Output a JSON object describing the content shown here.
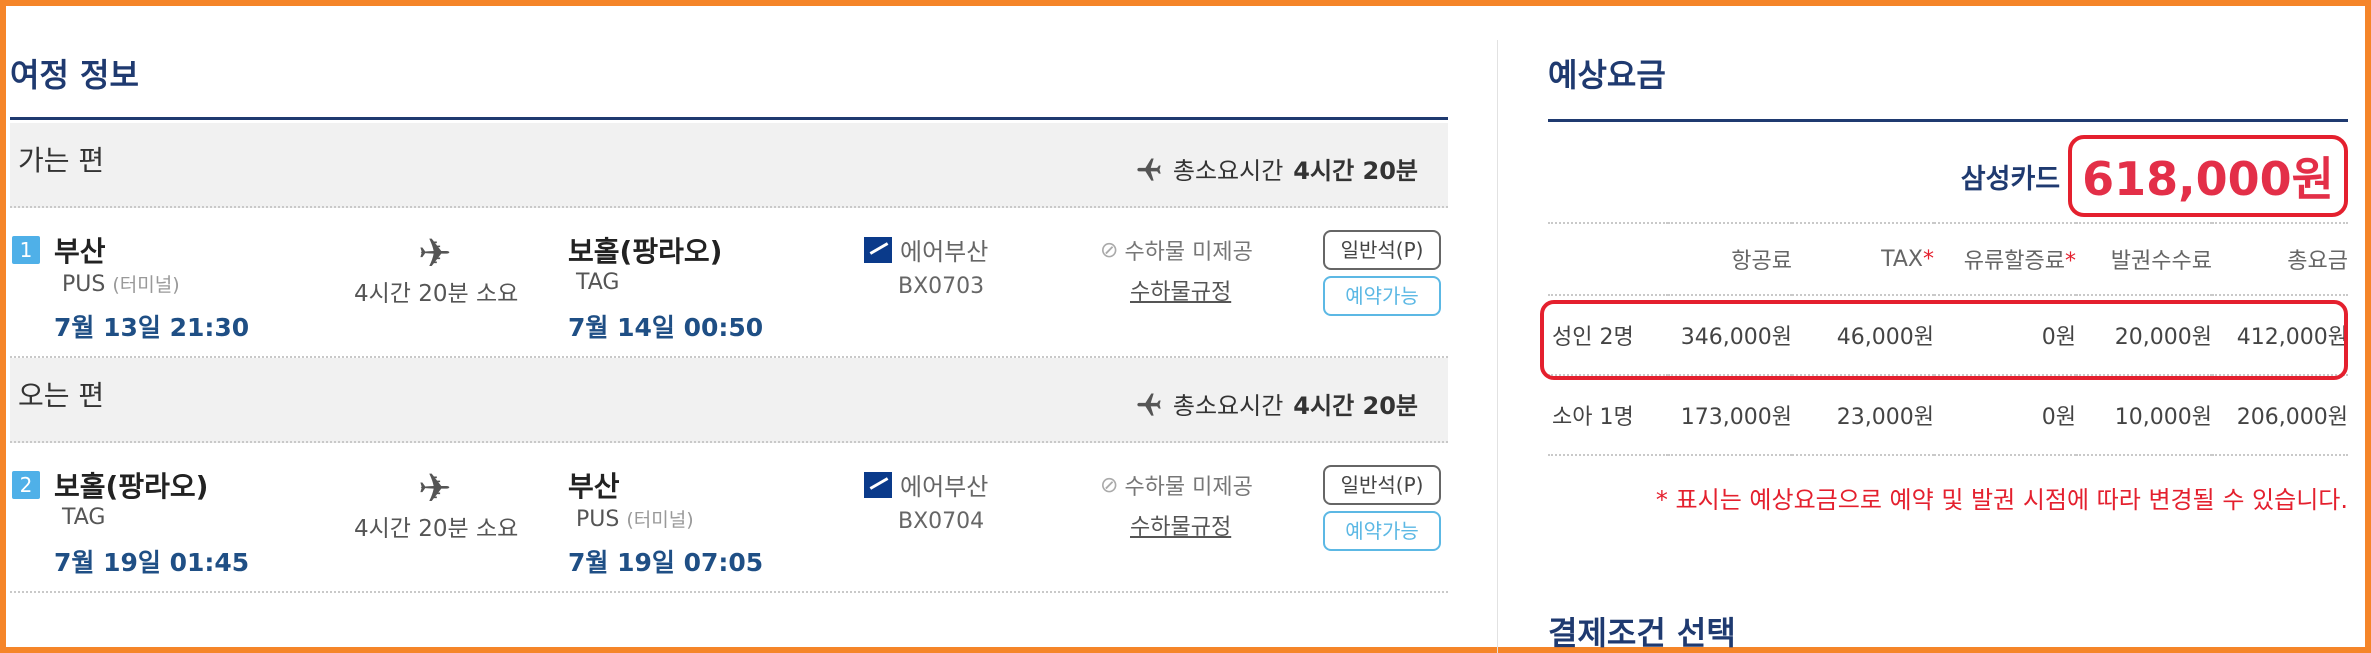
{
  "itinerary": {
    "title": "여정 정보",
    "segments": [
      {
        "label": "가는 편",
        "total_label": "총소요시간",
        "total_value": "4시간 20분",
        "number": "1",
        "dep_city": "부산",
        "dep_code": "PUS",
        "dep_terminal": "(터미널)",
        "dep_datetime": "7월 13일 21:30",
        "duration": "4시간 20분 소요",
        "arr_city": "보홀(팡라오)",
        "arr_code": "TAG",
        "arr_terminal": "",
        "arr_datetime": "7월 14일 00:50",
        "airline": "에어부산",
        "flight_no": "BX0703",
        "baggage": "수하물 미제공",
        "baggage_rule": "수하물규정",
        "seat_class": "일반석(P)",
        "availability": "예약가능"
      },
      {
        "label": "오는 편",
        "total_label": "총소요시간",
        "total_value": "4시간 20분",
        "number": "2",
        "dep_city": "보홀(팡라오)",
        "dep_code": "TAG",
        "dep_terminal": "",
        "dep_datetime": "7월 19일 01:45",
        "duration": "4시간 20분 소요",
        "arr_city": "부산",
        "arr_code": "PUS",
        "arr_terminal": "(터미널)",
        "arr_datetime": "7월 19일 07:05",
        "airline": "에어부산",
        "flight_no": "BX0704",
        "baggage": "수하물 미제공",
        "baggage_rule": "수하물규정",
        "seat_class": "일반석(P)",
        "availability": "예약가능"
      }
    ]
  },
  "fare": {
    "title": "예상요금",
    "card_name": "삼성카드",
    "card_price": "618,000원",
    "headers": [
      "",
      "항공료",
      "TAX",
      "유류할증료",
      "발권수수료",
      "총요금"
    ],
    "rows": [
      [
        "성인 2명",
        "346,000원",
        "46,000원",
        "0원",
        "20,000원",
        "412,000원"
      ],
      [
        "소아 1명",
        "173,000원",
        "23,000원",
        "0원",
        "10,000원",
        "206,000원"
      ]
    ],
    "required_mark": "*",
    "note": "* 표시는 예상요금으로 예약 및 발권 시점에 따라 변경될 수 있습니다.",
    "payment_title": "결제조건 선택"
  },
  "colors": {
    "navy": "#1f3a70",
    "red": "#e4202e",
    "frame": "#f58529",
    "sky": "#4fb0e8"
  }
}
